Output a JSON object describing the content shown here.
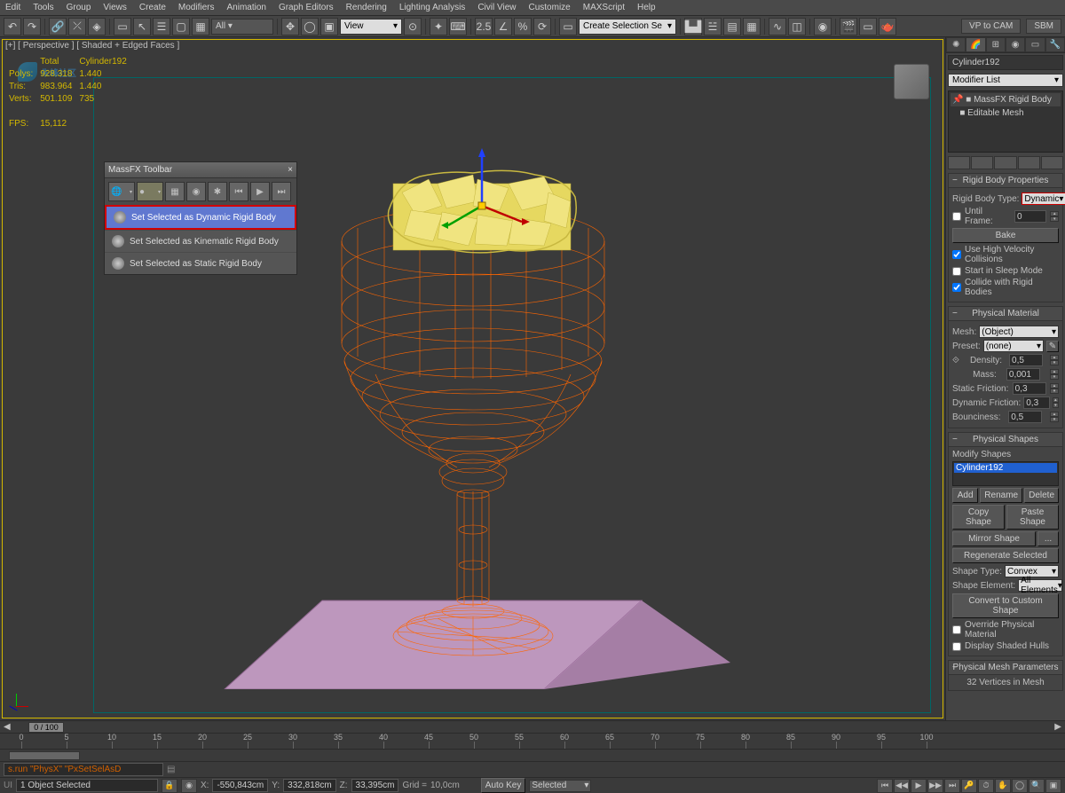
{
  "menubar": [
    "Edit",
    "Tools",
    "Group",
    "Views",
    "Create",
    "Modifiers",
    "Animation",
    "Graph Editors",
    "Rendering",
    "Lighting Analysis",
    "Civil View",
    "Customize",
    "MAXScript",
    "Help"
  ],
  "toolbar": {
    "view_combo": "View",
    "create_combo": "Create Selection Se",
    "vp_to_cam": "VP to CAM",
    "sbm": "SBM"
  },
  "viewport": {
    "label": "[+] [ Perspective ] [ Shaded + Edged Faces ]",
    "stats": {
      "headers": [
        "",
        "Total",
        "Cylinder192"
      ],
      "rows": [
        [
          "Polys:",
          "928.318",
          "1.440"
        ],
        [
          "Tris:",
          "983.964",
          "1.440"
        ],
        [
          "Verts:",
          "501.109",
          "735"
        ],
        [
          "",
          "",
          ""
        ],
        [
          "FPS:",
          "15,112",
          ""
        ]
      ]
    }
  },
  "massfx": {
    "title": "MassFX Toolbar",
    "items": [
      "Set Selected as Dynamic Rigid Body",
      "Set Selected as Kinematic Rigid Body",
      "Set Selected as Static Rigid Body"
    ]
  },
  "panel": {
    "object_name": "Cylinder192",
    "modifier_list": "Modifier List",
    "stack": [
      {
        "icon": "📌",
        "label": "MassFX Rigid Body",
        "sel": true
      },
      {
        "icon": "■",
        "label": "Editable Mesh",
        "sel": false
      }
    ],
    "rigid_body": {
      "title": "Rigid Body Properties",
      "type_label": "Rigid Body Type:",
      "type_value": "Dynamic",
      "until_frame_label": "Until Frame:",
      "until_frame_value": "0",
      "bake": "Bake",
      "chk_high_vel": "Use High Velocity Collisions",
      "chk_sleep": "Start in Sleep Mode",
      "chk_collide": "Collide with Rigid Bodies"
    },
    "phys_mat": {
      "title": "Physical Material",
      "mesh_label": "Mesh:",
      "mesh_value": "(Object)",
      "preset_label": "Preset:",
      "preset_value": "(none)",
      "density_label": "Density:",
      "density_value": "0,5",
      "mass_label": "Mass:",
      "mass_value": "0,001",
      "static_friction_label": "Static Friction:",
      "static_friction_value": "0,3",
      "dynamic_friction_label": "Dynamic Friction:",
      "dynamic_friction_value": "0,3",
      "bounciness_label": "Bounciness:",
      "bounciness_value": "0,5"
    },
    "phys_shapes": {
      "title": "Physical Shapes",
      "modify_label": "Modify Shapes",
      "list_item": "Cylinder192",
      "add": "Add",
      "rename": "Rename",
      "delete": "Delete",
      "copy": "Copy Shape",
      "paste": "Paste Shape",
      "mirror": "Mirror Shape",
      "dots": "...",
      "regen": "Regenerate Selected",
      "shape_type_label": "Shape Type:",
      "shape_type_value": "Convex",
      "shape_element_label": "Shape Element:",
      "shape_element_value": "All Elements",
      "convert": "Convert to Custom Shape",
      "override": "Override Physical Material",
      "display_hulls": "Display Shaded Hulls"
    },
    "phys_mesh": {
      "title": "Physical Mesh Parameters",
      "info": "32 Vertices in Mesh"
    }
  },
  "timeline": {
    "slider": "0 / 100",
    "ticks": [
      "0",
      "5",
      "10",
      "15",
      "20",
      "25",
      "30",
      "35",
      "40",
      "45",
      "50",
      "55",
      "60",
      "65",
      "70",
      "75",
      "80",
      "85",
      "90",
      "95",
      "100"
    ]
  },
  "status": {
    "script": "s.run \"PhysX\" \"PxSetSelAsD",
    "selection": "1 Object Selected",
    "x_label": "X:",
    "x_value": "-550,843cm",
    "y_label": "Y:",
    "y_value": "332,818cm",
    "z_label": "Z:",
    "z_value": "33,395cm",
    "grid_label": "Grid =",
    "grid_value": "10,0cm",
    "auto_key": "Auto Key",
    "key_mode": "Selected"
  },
  "watermark": "朱峰社区"
}
